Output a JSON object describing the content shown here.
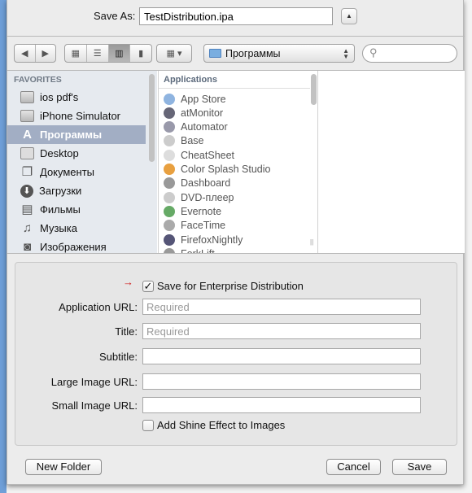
{
  "save_as": {
    "label": "Save As:",
    "value": "TestDistribution.ipa"
  },
  "toolbar": {
    "path": "Программы",
    "search_placeholder": "",
    "view_mode": "columns"
  },
  "sidebar": {
    "header": "FAVORITES",
    "items": [
      {
        "label": "ios pdf's",
        "icon": "folder-icon"
      },
      {
        "label": "iPhone Simulator",
        "icon": "folder-icon"
      },
      {
        "label": "Программы",
        "icon": "applications-icon",
        "selected": true
      },
      {
        "label": "Desktop",
        "icon": "desktop-icon"
      },
      {
        "label": "Документы",
        "icon": "documents-icon"
      },
      {
        "label": "Загрузки",
        "icon": "downloads-icon"
      },
      {
        "label": "Фильмы",
        "icon": "movies-icon"
      },
      {
        "label": "Музыка",
        "icon": "music-icon"
      },
      {
        "label": "Изображения",
        "icon": "pictures-icon"
      }
    ]
  },
  "column": {
    "header": "Applications",
    "items": [
      "App Store",
      "atMonitor",
      "Automator",
      "Base",
      "CheatSheet",
      "Color Splash Studio",
      "Dashboard",
      "DVD-плеер",
      "Evernote",
      "FaceTime",
      "FirefoxNightly",
      "ForkLift"
    ]
  },
  "enterprise": {
    "checkbox_label": "Save for Enterprise Distribution",
    "checked": true,
    "fields": [
      {
        "label": "Application URL:",
        "placeholder": "Required",
        "value": ""
      },
      {
        "label": "Title:",
        "placeholder": "Required",
        "value": ""
      },
      {
        "label": "Subtitle:",
        "placeholder": "",
        "value": ""
      },
      {
        "label": "Large Image URL:",
        "placeholder": "",
        "value": ""
      },
      {
        "label": "Small Image URL:",
        "placeholder": "",
        "value": ""
      }
    ],
    "shine_label": "Add Shine Effect to Images",
    "shine_checked": false,
    "arrow_color": "#d02020"
  },
  "buttons": {
    "new_folder": "New Folder",
    "cancel": "Cancel",
    "save": "Save"
  }
}
